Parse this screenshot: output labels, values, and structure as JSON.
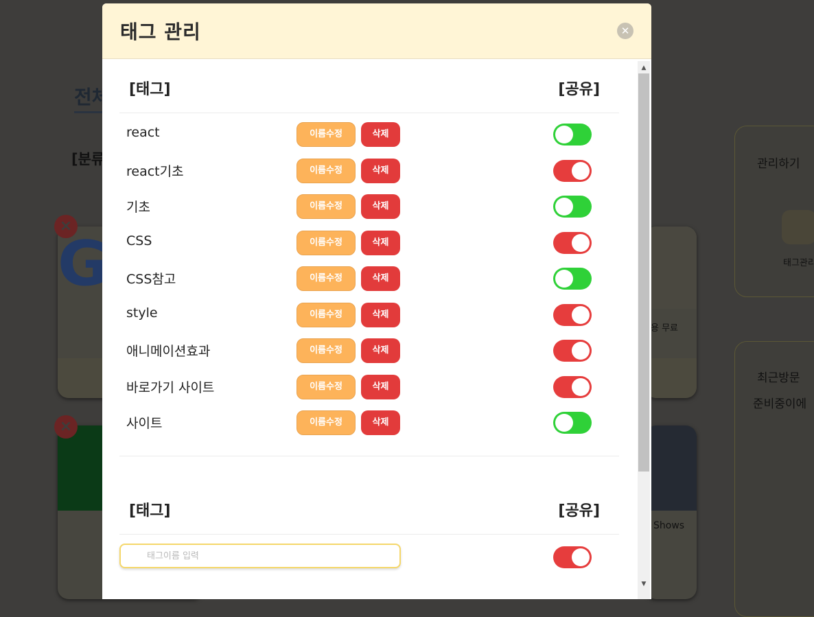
{
  "background": {
    "page_title": "전체",
    "category_label": "[분류",
    "manage_label": "관리하기",
    "tag_manage_short": "태그관리",
    "recent_label": "최근방문",
    "preparing_label": "준비중이에",
    "card1_caption": "용 무료",
    "card2_caption": "Shows"
  },
  "modal": {
    "title": "태그 관리",
    "close_icon": "close-icon",
    "section_tag_label": "[태그]",
    "section_share_label": "[공유]",
    "rename_label": "이름수정",
    "delete_label": "삭제",
    "tags": [
      {
        "name": "react",
        "shared": false
      },
      {
        "name": "react기초",
        "shared": true
      },
      {
        "name": "기초",
        "shared": false
      },
      {
        "name": "CSS",
        "shared": true
      },
      {
        "name": "CSS참고",
        "shared": false
      },
      {
        "name": "style",
        "shared": true
      },
      {
        "name": "애니메이션효과",
        "shared": true
      },
      {
        "name": "바로가기 사이트",
        "shared": true
      },
      {
        "name": "사이트",
        "shared": false
      }
    ],
    "new_tag": {
      "section_tag_label": "[태그]",
      "section_share_label": "[공유]",
      "placeholder": "태그이름 입력",
      "value": "",
      "shared": true
    }
  },
  "colors": {
    "header_bg": "#fff5d6",
    "rename_btn": "#fdb35a",
    "delete_btn": "#e23b3b",
    "toggle_on": "#e63d3d",
    "toggle_off": "#2fd138"
  }
}
